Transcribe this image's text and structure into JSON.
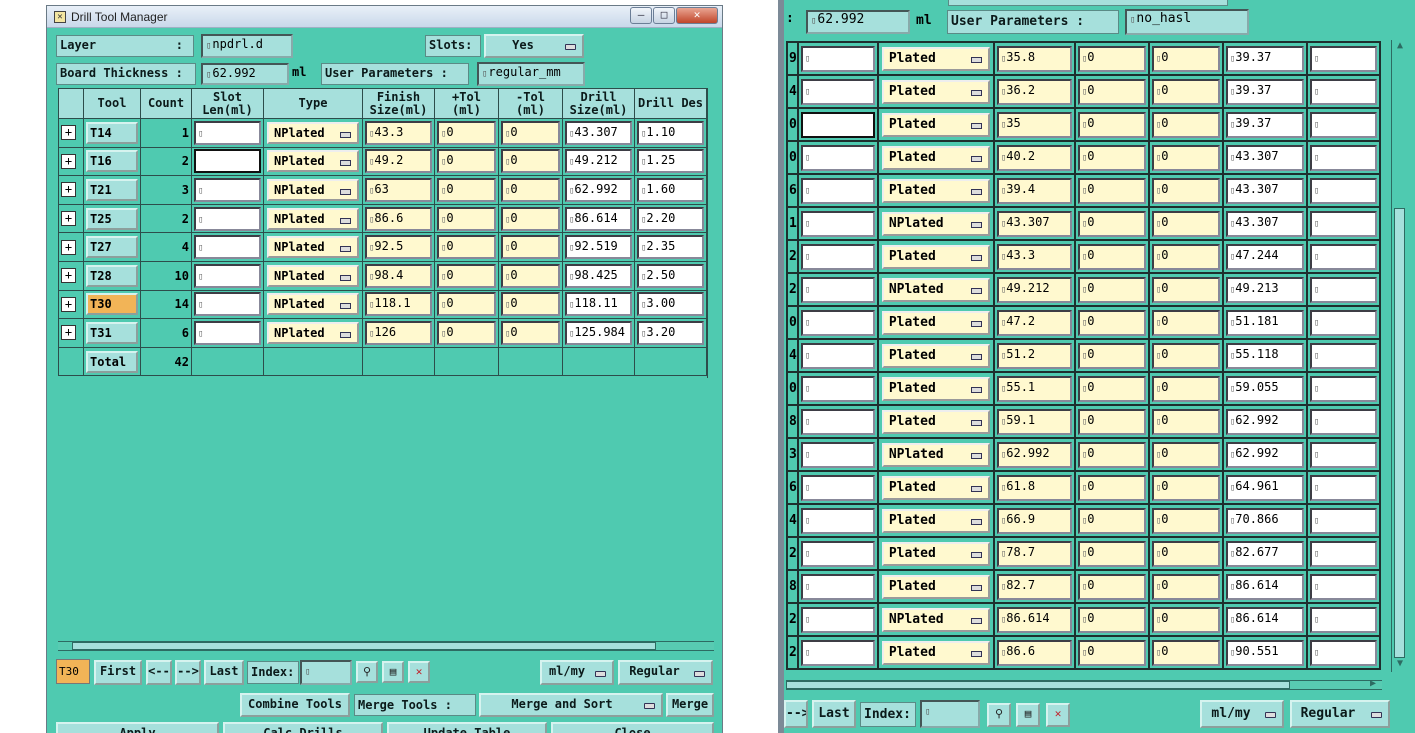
{
  "window_title": "Drill Tool Manager",
  "layer": {
    "label": "Layer",
    "colon": ":",
    "value": "npdrl.d"
  },
  "slots": {
    "label": "Slots:",
    "value": "Yes"
  },
  "board": {
    "label": "Board Thickness :",
    "value": "62.992",
    "unit": "ml"
  },
  "user_params": {
    "label": "User Parameters :",
    "value": "regular_mm"
  },
  "table_headers": [
    "Tool",
    "Count",
    "Slot Len(ml)",
    "Type",
    "Finish Size(ml)",
    "+Tol (ml)",
    "-Tol (ml)",
    "Drill Size(ml)",
    "Drill Des"
  ],
  "tools": [
    {
      "tool": "T14",
      "count": "1",
      "slot": "",
      "type": "NPlated",
      "finish": "43.3",
      "ptol": "0",
      "ntol": "0",
      "drill": "43.307",
      "des": "1.10"
    },
    {
      "tool": "T16",
      "count": "2",
      "slot": "",
      "type": "NPlated",
      "finish": "49.2",
      "ptol": "0",
      "ntol": "0",
      "drill": "49.212",
      "des": "1.25"
    },
    {
      "tool": "T21",
      "count": "3",
      "slot": "",
      "type": "NPlated",
      "finish": "63",
      "ptol": "0",
      "ntol": "0",
      "drill": "62.992",
      "des": "1.60"
    },
    {
      "tool": "T25",
      "count": "2",
      "slot": "",
      "type": "NPlated",
      "finish": "86.6",
      "ptol": "0",
      "ntol": "0",
      "drill": "86.614",
      "des": "2.20"
    },
    {
      "tool": "T27",
      "count": "4",
      "slot": "",
      "type": "NPlated",
      "finish": "92.5",
      "ptol": "0",
      "ntol": "0",
      "drill": "92.519",
      "des": "2.35"
    },
    {
      "tool": "T28",
      "count": "10",
      "slot": "",
      "type": "NPlated",
      "finish": "98.4",
      "ptol": "0",
      "ntol": "0",
      "drill": "98.425",
      "des": "2.50"
    },
    {
      "tool": "T30",
      "count": "14",
      "slot": "",
      "type": "NPlated",
      "finish": "118.1",
      "ptol": "0",
      "ntol": "0",
      "drill": "118.11",
      "des": "3.00"
    },
    {
      "tool": "T31",
      "count": "6",
      "slot": "",
      "type": "NPlated",
      "finish": "126",
      "ptol": "0",
      "ntol": "0",
      "drill": "125.984",
      "des": "3.20"
    }
  ],
  "total": {
    "label": "Total",
    "count": "42"
  },
  "nav": {
    "current": "T30",
    "first": "First",
    "prev": "<--",
    "next": "-->",
    "last": "Last",
    "index_label": "Index:",
    "units": "ml/my",
    "mode": "Regular"
  },
  "actions": {
    "combine": "Combine Tools",
    "merge_label": "Merge Tools :",
    "merge_value": "Merge and Sort",
    "merge": "Merge",
    "apply": "Apply",
    "calc": "Calc Drills",
    "update": "Update Table",
    "close": "Close"
  },
  "right": {
    "board_value": "62.992",
    "unit": "ml",
    "user_params_label": "User Parameters :",
    "user_params_value": "no_hasl",
    "rows": [
      {
        "rn": "9",
        "type": "Plated",
        "finish": "35.8",
        "ptol": "0",
        "ntol": "0",
        "drill": "39.37"
      },
      {
        "rn": "4",
        "type": "Plated",
        "finish": "36.2",
        "ptol": "0",
        "ntol": "0",
        "drill": "39.37"
      },
      {
        "rn": "0",
        "type": "Plated",
        "finish": "35",
        "ptol": "0",
        "ntol": "0",
        "drill": "39.37"
      },
      {
        "rn": "0",
        "type": "Plated",
        "finish": "40.2",
        "ptol": "0",
        "ntol": "0",
        "drill": "43.307"
      },
      {
        "rn": "6",
        "type": "Plated",
        "finish": "39.4",
        "ptol": "0",
        "ntol": "0",
        "drill": "43.307"
      },
      {
        "rn": "1",
        "type": "NPlated",
        "finish": "43.307",
        "ptol": "0",
        "ntol": "0",
        "drill": "43.307"
      },
      {
        "rn": "2",
        "type": "Plated",
        "finish": "43.3",
        "ptol": "0",
        "ntol": "0",
        "drill": "47.244"
      },
      {
        "rn": "2",
        "type": "NPlated",
        "finish": "49.212",
        "ptol": "0",
        "ntol": "0",
        "drill": "49.213"
      },
      {
        "rn": "0",
        "type": "Plated",
        "finish": "47.2",
        "ptol": "0",
        "ntol": "0",
        "drill": "51.181"
      },
      {
        "rn": "4",
        "type": "Plated",
        "finish": "51.2",
        "ptol": "0",
        "ntol": "0",
        "drill": "55.118"
      },
      {
        "rn": "0",
        "type": "Plated",
        "finish": "55.1",
        "ptol": "0",
        "ntol": "0",
        "drill": "59.055"
      },
      {
        "rn": "8",
        "type": "Plated",
        "finish": "59.1",
        "ptol": "0",
        "ntol": "0",
        "drill": "62.992"
      },
      {
        "rn": "3",
        "type": "NPlated",
        "finish": "62.992",
        "ptol": "0",
        "ntol": "0",
        "drill": "62.992"
      },
      {
        "rn": "6",
        "type": "Plated",
        "finish": "61.8",
        "ptol": "0",
        "ntol": "0",
        "drill": "64.961"
      },
      {
        "rn": "4",
        "type": "Plated",
        "finish": "66.9",
        "ptol": "0",
        "ntol": "0",
        "drill": "70.866"
      },
      {
        "rn": "2",
        "type": "Plated",
        "finish": "78.7",
        "ptol": "0",
        "ntol": "0",
        "drill": "82.677"
      },
      {
        "rn": "8",
        "type": "Plated",
        "finish": "82.7",
        "ptol": "0",
        "ntol": "0",
        "drill": "86.614"
      },
      {
        "rn": "2",
        "type": "NPlated",
        "finish": "86.614",
        "ptol": "0",
        "ntol": "0",
        "drill": "86.614"
      },
      {
        "rn": "2",
        "type": "Plated",
        "finish": "86.6",
        "ptol": "0",
        "ntol": "0",
        "drill": "90.551"
      }
    ],
    "nav": {
      "next": "-->",
      "last": "Last",
      "index_label": "Index:",
      "units": "ml/my",
      "mode": "Regular"
    }
  }
}
